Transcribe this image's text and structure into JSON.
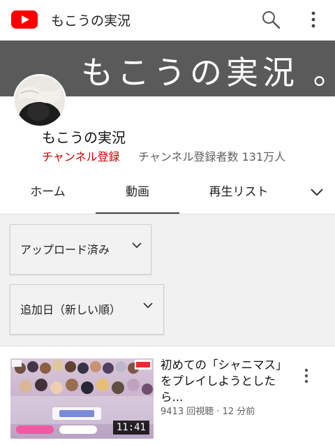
{
  "app": {
    "title": "もこうの実況"
  },
  "banner": {
    "text": "もこうの実況 。"
  },
  "channel": {
    "name": "もこうの実況",
    "subscribe_label": "チャンネル登録",
    "subscriber_count": "チャンネル登録者数 131万人"
  },
  "tabs": [
    {
      "label": "ホーム"
    },
    {
      "label": "動画"
    },
    {
      "label": "再生リスト"
    }
  ],
  "filters": [
    {
      "label": "アップロード済み"
    },
    {
      "label": "追加日（新しい順）"
    }
  ],
  "video": {
    "title": "初めての「シャニマス」をプレイしようとしたら...",
    "meta": "9413 回視聴 · 12 分前",
    "duration": "11:41"
  },
  "colors": {
    "brand_red": "#ff0000",
    "subscribe_red": "#cc0000",
    "banner_bg": "#5a5a5a"
  }
}
